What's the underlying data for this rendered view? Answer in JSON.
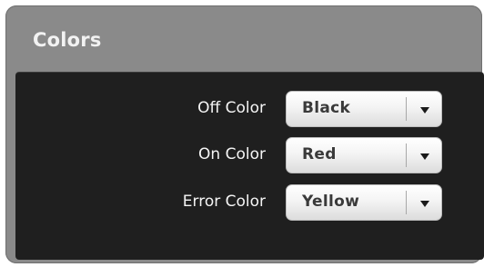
{
  "panel": {
    "title": "Colors"
  },
  "fields": [
    {
      "label": "Off Color",
      "value": "Black",
      "icon": "chevron-down-icon"
    },
    {
      "label": "On Color",
      "value": "Red",
      "icon": "chevron-down-icon"
    },
    {
      "label": "Error Color",
      "value": "Yellow",
      "icon": "chevron-down-icon"
    }
  ],
  "colors": {
    "panel_header": "#8a8a8a",
    "panel_body": "#1f1f1f",
    "label_text": "#f5f5f5",
    "select_text": "#3a3a3a"
  }
}
